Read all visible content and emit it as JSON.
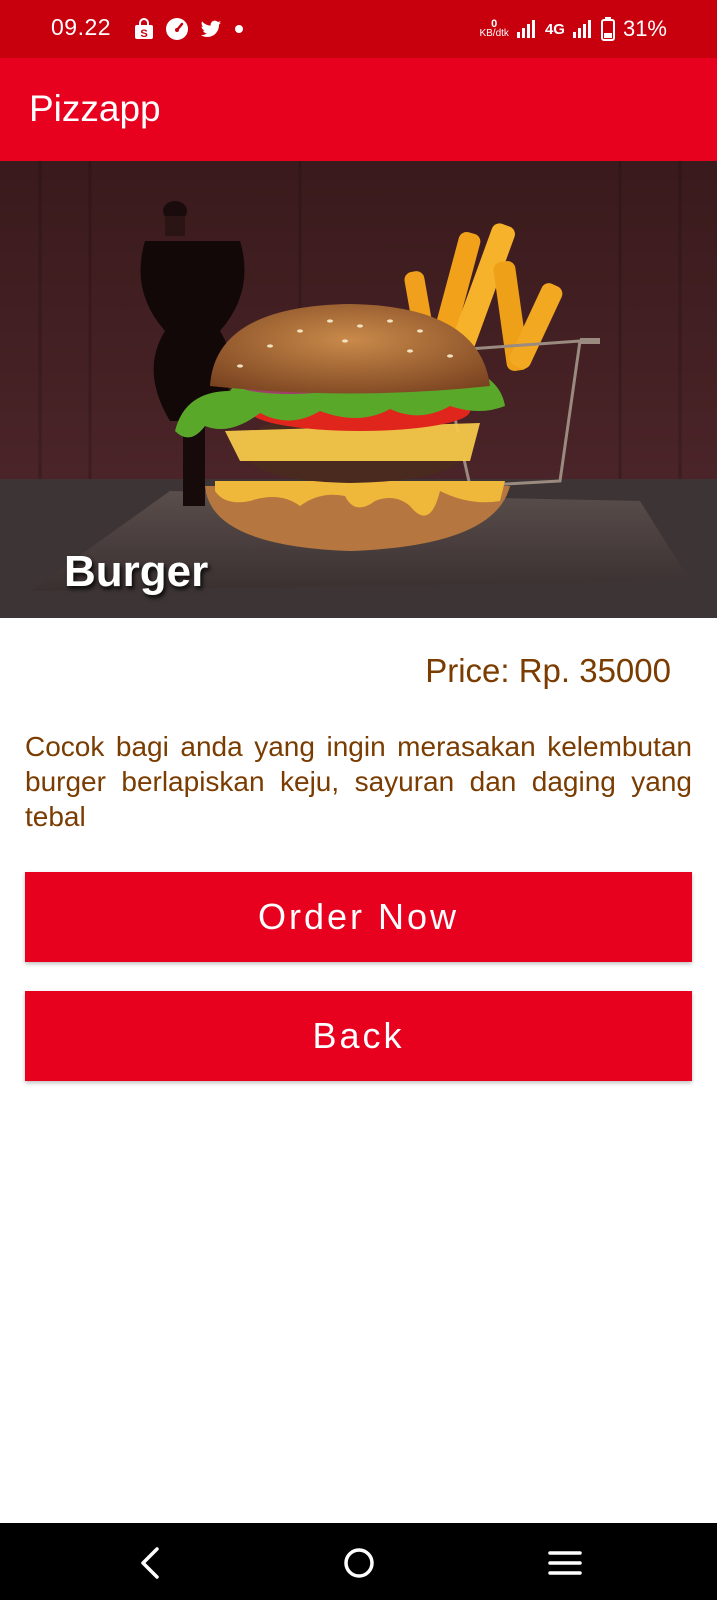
{
  "status_bar": {
    "time": "09.22",
    "left_icons": [
      "shopee-bag-icon",
      "speed-icon",
      "twitter-icon",
      "notification-dot-icon"
    ],
    "data_speed_value": "0",
    "data_speed_unit": "KB/dtk",
    "network_type": "4G",
    "battery_percent": "31%",
    "background_color": "#c8000e"
  },
  "app_bar": {
    "title": "Pizzapp",
    "background_color": "#e8001f"
  },
  "hero": {
    "title": "Burger"
  },
  "product": {
    "price": "Price: Rp. 35000",
    "description": "Cocok bagi anda yang ingin merasakan kelembutan burger berlapiskan keju, sayuran dan daging yang tebal",
    "text_color": "#7a3c00"
  },
  "buttons": {
    "order_label": "Order Now",
    "back_label": "Back",
    "color": "#e8001f"
  },
  "nav_bar": {
    "icons": [
      "back-icon",
      "home-icon",
      "menu-icon"
    ]
  }
}
